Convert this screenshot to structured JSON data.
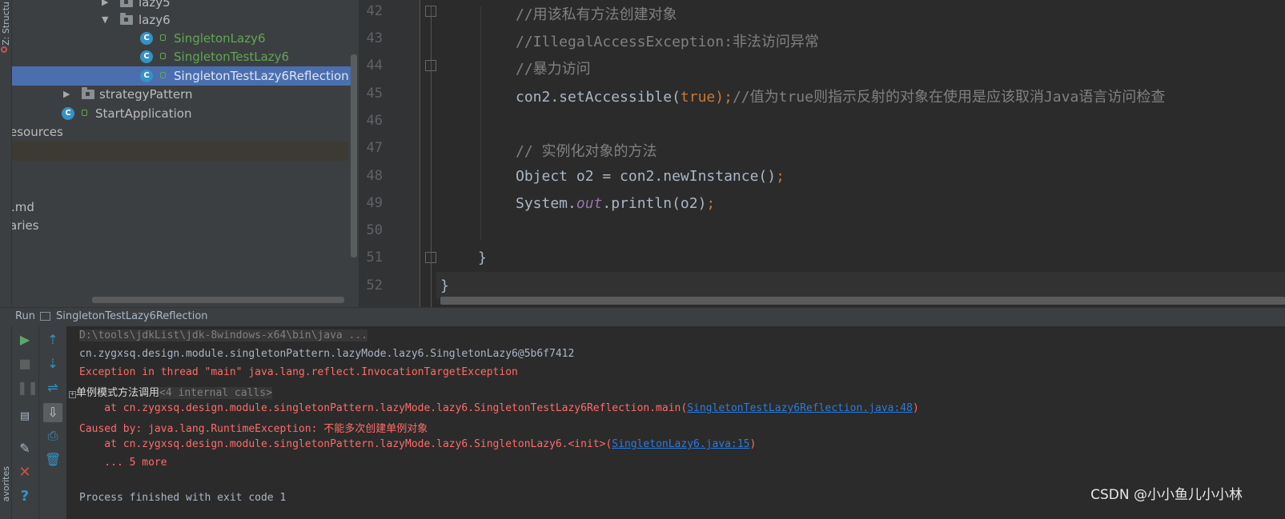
{
  "left_strip": {
    "structure_label": "Z: Structu",
    "favorites_label": "avorites"
  },
  "project_tree": {
    "items": [
      {
        "label": "lazy5"
      },
      {
        "label": "lazy6"
      },
      {
        "label": "SingletonLazy6"
      },
      {
        "label": "SingletonTestLazy6"
      },
      {
        "label": "SingletonTestLazy6Reflection"
      },
      {
        "label": "strategyPattern"
      },
      {
        "label": "StartApplication"
      },
      {
        "label": "esources"
      },
      {
        "label": ".md"
      },
      {
        "label": "aries"
      }
    ]
  },
  "editor": {
    "lines": [
      {
        "num": "42",
        "text": "//用该私有方法创建对象"
      },
      {
        "num": "43",
        "text": "//IllegalAccessException:非法访问异常"
      },
      {
        "num": "44",
        "text": "//暴力访问"
      },
      {
        "num": "45",
        "a": "con2.setAccessible(",
        "kw": "true",
        "b": ");",
        "cmt": "//值为true则指示反射的对象在使用是应该取消Java语言访问检查"
      },
      {
        "num": "46"
      },
      {
        "num": "47",
        "text": "// 实例化对象的方法"
      },
      {
        "num": "48",
        "a": "Object o2 = con2.newInstance()",
        "semi": ";"
      },
      {
        "num": "49",
        "a": "System.",
        "field": "out",
        "b": ".println(o2)",
        "semi": ";"
      },
      {
        "num": "50"
      },
      {
        "num": "51",
        "text": "}"
      },
      {
        "num": "52",
        "text": "}"
      }
    ]
  },
  "run": {
    "tab_label": "Run",
    "config_name": "SingletonTestLazy6Reflection"
  },
  "console": {
    "cmd": "D:\\tools\\jdkList\\jdk-8windows-x64\\bin\\java ...",
    "line1": "cn.zygxsq.design.module.singletonPattern.lazyMode.lazy6.SingletonLazy6@5b6f7412",
    "line2": "Exception in thread \"main\" java.lang.reflect.InvocationTargetException",
    "line3_label": "单例模式方法调用",
    "line3_internal": "<4 internal calls>",
    "line4_prefix": "    at cn.zygxsq.design.module.singletonPattern.lazyMode.lazy6.SingletonTestLazy6Reflection.main(",
    "line4_link": "SingletonTestLazy6Reflection.java:48",
    "line4_suffix": ")",
    "line5": "Caused by: java.lang.RuntimeException: 不能多次创建单例对象",
    "line6_prefix": "    at cn.zygxsq.design.module.singletonPattern.lazyMode.lazy6.SingletonLazy6.<init>(",
    "line6_link": "SingletonLazy6.java:15",
    "line6_suffix": ")",
    "line7": "    ... 5 more",
    "line8": "Process finished with exit code 1"
  },
  "watermark": "CSDN @小小鱼儿小小林",
  "colors": {
    "accent_selection": "#4b6eaf",
    "error": "#ff6b68",
    "link": "#287bde",
    "keyword": "#cc7832",
    "comment": "#808080"
  }
}
